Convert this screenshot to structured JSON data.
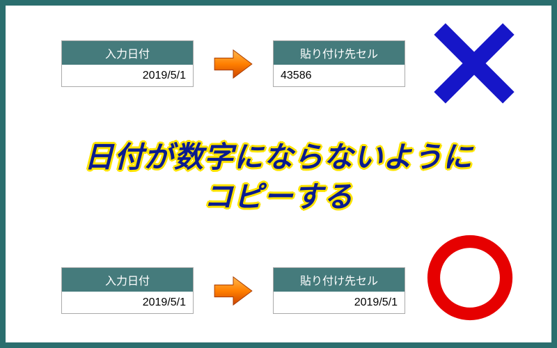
{
  "row1": {
    "source": {
      "header": "入力日付",
      "value": "2019/5/1"
    },
    "target": {
      "header": "貼り付け先セル",
      "value": "43586"
    }
  },
  "row2": {
    "source": {
      "header": "入力日付",
      "value": "2019/5/1"
    },
    "target": {
      "header": "貼り付け先セル",
      "value": "2019/5/1"
    }
  },
  "mainText": {
    "line1": "日付が数字にならないように",
    "line2": "コピーする"
  },
  "colors": {
    "border": "#2a6e6e",
    "header": "#457b7c",
    "textMain": "#0a1b8f",
    "textOutline": "#ffe400",
    "cross": "#1616c8",
    "circle": "#e60000"
  }
}
